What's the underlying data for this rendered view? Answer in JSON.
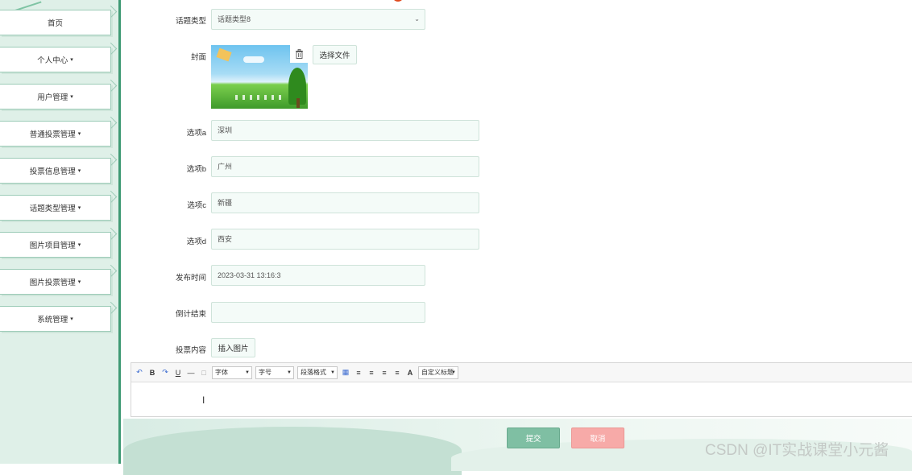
{
  "sidebar": {
    "items": [
      {
        "label": "首页",
        "has_caret": false
      },
      {
        "label": "个人中心",
        "has_caret": true
      },
      {
        "label": "用户管理",
        "has_caret": true
      },
      {
        "label": "普通投票管理",
        "has_caret": true
      },
      {
        "label": "投票信息管理",
        "has_caret": true
      },
      {
        "label": "话题类型管理",
        "has_caret": true
      },
      {
        "label": "图片项目管理",
        "has_caret": true
      },
      {
        "label": "图片投票管理",
        "has_caret": true
      },
      {
        "label": "系统管理",
        "has_caret": true
      }
    ],
    "caret_glyph": "▾"
  },
  "form": {
    "topic_type": {
      "label": "话题类型",
      "value": "话题类型8"
    },
    "cover": {
      "label": "封面",
      "choose_file": "选择文件",
      "trash_icon": "trash-icon"
    },
    "option_a": {
      "label": "选项a",
      "value": "深圳"
    },
    "option_b": {
      "label": "选项b",
      "value": "广州"
    },
    "option_c": {
      "label": "选项c",
      "value": "新疆"
    },
    "option_d": {
      "label": "选项d",
      "value": "西安"
    },
    "publish_time": {
      "label": "发布时间",
      "value": "2023-03-31 13:16:3"
    },
    "countdown_end": {
      "label": "倒计结束",
      "value": ""
    },
    "vote_content": {
      "label": "投票内容",
      "insert_image": "插入图片"
    }
  },
  "editor": {
    "toolbar": {
      "undo": "↶",
      "bold": "B",
      "redo": "↷",
      "underline": "U",
      "hr": "—",
      "blank": "□",
      "font_family": "字体",
      "font_size": "字号",
      "paragraph": "段落格式",
      "table": "▦",
      "align_left": "≡",
      "align_right": "≡",
      "align_center": "≡",
      "justify": "≡",
      "font_color": "A",
      "custom_title": "自定义标题"
    }
  },
  "actions": {
    "submit": "提交",
    "cancel": "取消"
  },
  "watermark": "CSDN @IT实战课堂小元酱",
  "colors": {
    "accent": "#3f9a74",
    "submit": "#7fbfa3",
    "cancel": "#f7aaa8",
    "sidebar_bg": "#dff0e8"
  }
}
